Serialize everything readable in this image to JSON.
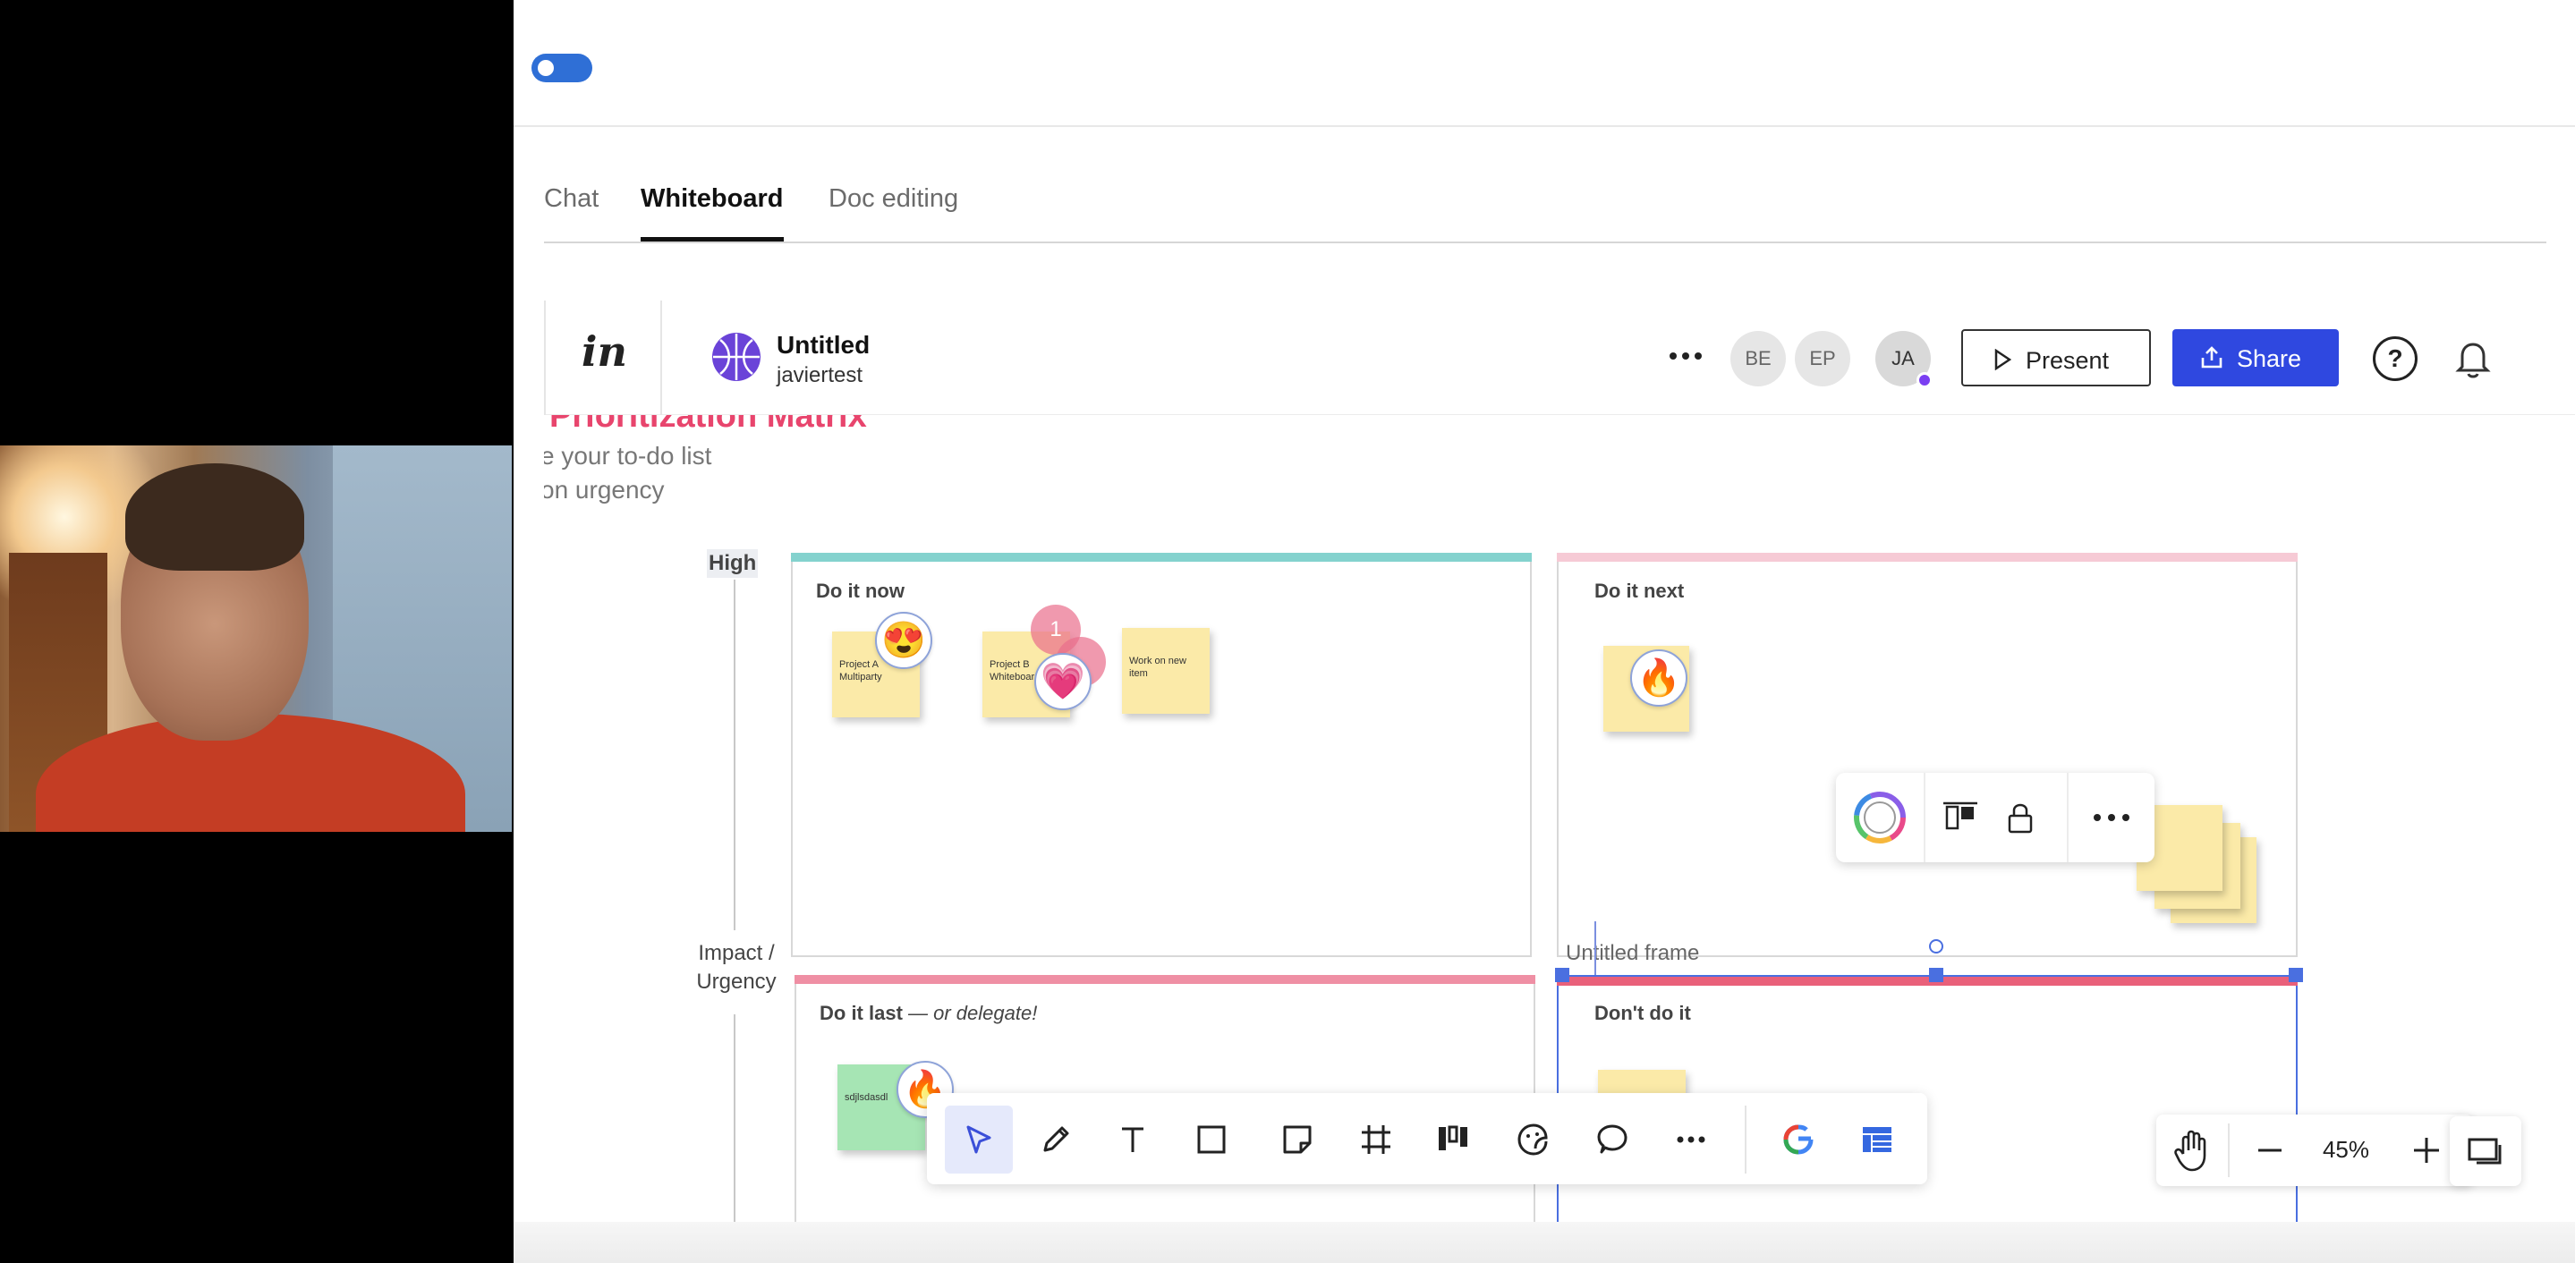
{
  "tabs": [
    {
      "label": "Chat"
    },
    {
      "label": "Whiteboard"
    },
    {
      "label": "Doc editing"
    }
  ],
  "whiteboard_header": {
    "logo": "in",
    "doc_title": "Untitled",
    "doc_owner": "javiertest",
    "avatars": [
      "BE",
      "EP",
      "JA"
    ],
    "present_label": "Present",
    "share_label": "Share",
    "help_label": "?"
  },
  "canvas": {
    "matrix_title": "Prioritization Matrix",
    "subtitle_line1": "e your to-do list",
    "subtitle_line2": "on urgency",
    "axis_high": "High",
    "axis_mid_line1": "Impact /",
    "axis_mid_line2": "Urgency",
    "quadrants": {
      "do_it_now": "Do it now",
      "do_it_next": "Do it next",
      "do_it_last": "Do it last",
      "do_it_last_suffix": " — or delegate!",
      "dont_do_it": "Don't do it"
    },
    "stickies": {
      "project_a": "Project A Multiparty",
      "project_b": "Project B Whiteboard",
      "work_new": "Work on new item",
      "green_note": "sdjlsdasdl"
    },
    "reaction_count": "1",
    "frame_label": "Untitled frame"
  },
  "zoom": {
    "level": "45%"
  },
  "colors": {
    "accent_blue": "#2f48e0",
    "teal_bar": "#84d2ce",
    "pink_bar": "#f6cad5",
    "red_bar": "#e9607a",
    "title_pink": "#e8456d",
    "sticky_yellow": "#fbeaa8",
    "sticky_green": "#a6e5b4"
  },
  "icons": {
    "toolbar": [
      "cursor-icon",
      "pencil-icon",
      "text-icon",
      "rectangle-icon",
      "sticky-note-icon",
      "grid-frame-icon",
      "columns-icon",
      "sticker-icon",
      "comment-icon",
      "more-icon",
      "google-icon",
      "template-icon"
    ]
  }
}
